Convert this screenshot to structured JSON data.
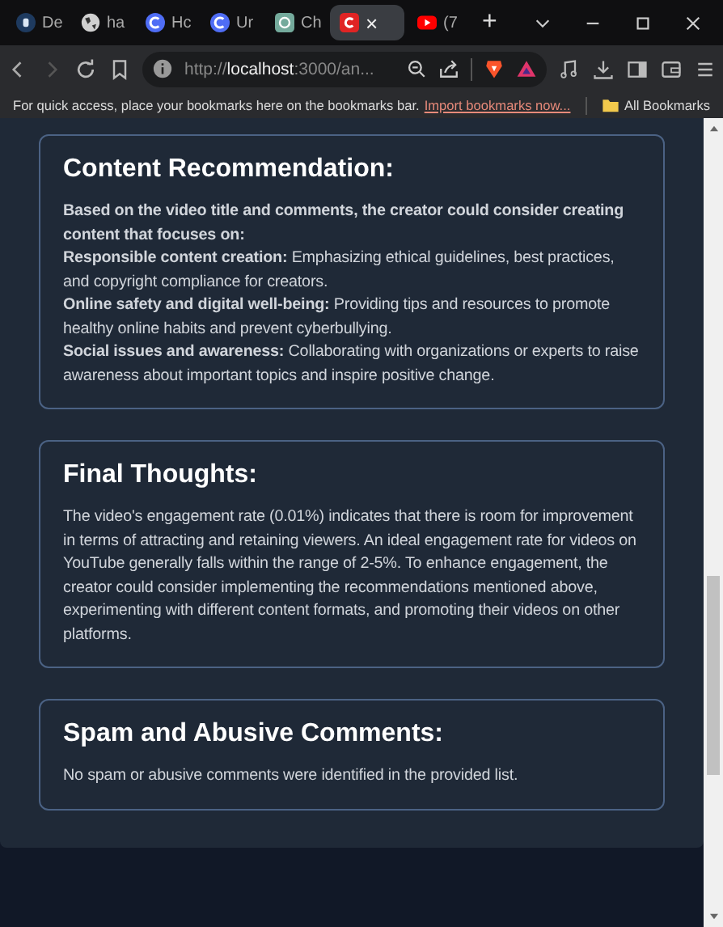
{
  "tabs": [
    {
      "label": "De",
      "kind": "letter",
      "selected": false
    },
    {
      "label": "ha",
      "kind": "globe",
      "selected": false
    },
    {
      "label": "Hc",
      "kind": "ring",
      "selected": false
    },
    {
      "label": "Ur",
      "kind": "ring",
      "selected": false
    },
    {
      "label": "Ch",
      "kind": "knot",
      "selected": false
    },
    {
      "kind": "red",
      "selected": true
    },
    {
      "label": "(7",
      "kind": "play",
      "selected": false
    }
  ],
  "tab_close": "×",
  "new_tab": "+",
  "address_bar": {
    "url": "http://**localhost**:3000/an..."
  },
  "bookmarks_bar": {
    "hint": "For quick access, place your bookmarks here on the bookmarks bar.",
    "import_link": "Import bookmarks now...",
    "all_bookmarks": "All Bookmarks"
  },
  "sections": [
    {
      "title": "Content Recommendation:",
      "paragraphs": [
        {
          "kind": "lead",
          "text": "Based on the video title and comments, the creator could consider creating content that focuses on:"
        },
        {
          "kind": "point",
          "text": "**Responsible content creation:** Emphasizing ethical guidelines, best practices, and copyright compliance for creators."
        },
        {
          "kind": "point",
          "text": "**Online safety and digital well-being:** Providing tips and resources to promote healthy online habits and prevent cyberbullying."
        },
        {
          "kind": "point",
          "text": "**Social issues and awareness:** Collaborating with organizations or experts to raise awareness about important topics and inspire positive change."
        }
      ]
    },
    {
      "title": "Final Thoughts:",
      "paragraphs": [
        {
          "kind": "body",
          "text": "The video's engagement rate (0.01%) indicates that there is room for improvement in terms of attracting and retaining viewers. An ideal engagement rate for videos on YouTube generally falls within the range of 2-5%. To enhance engagement, the creator could consider implementing the recommendations mentioned above, experimenting with different content formats, and promoting their videos on other platforms."
        }
      ]
    },
    {
      "title": "Spam and Abusive Comments:",
      "paragraphs": [
        {
          "kind": "body",
          "text": "No spam or abusive comments were identified in the provided list."
        }
      ]
    }
  ]
}
